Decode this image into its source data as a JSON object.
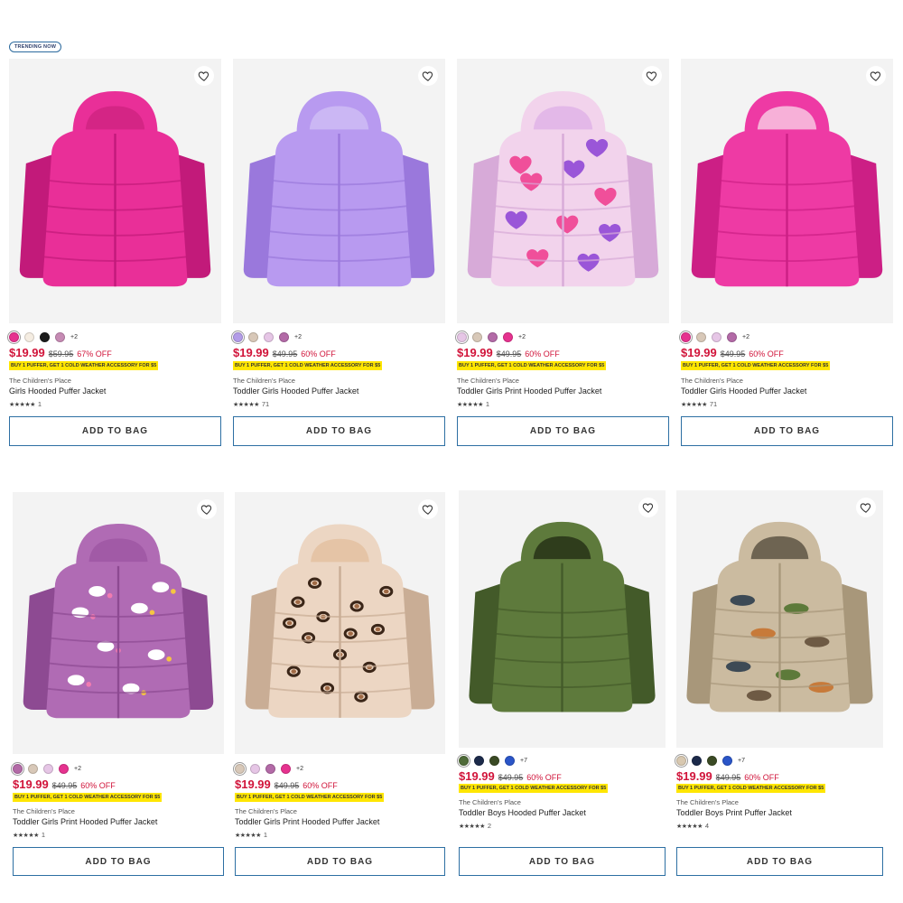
{
  "trending_label": "TRENDING NOW",
  "products": [
    {
      "brand": "The Children's Place",
      "name": "Girls Hooded Puffer Jacket",
      "price": "$19.99",
      "was": "$59.95",
      "off": "67% OFF",
      "promo": "BUY 1 PUFFER, GET 1 COLD WEATHER ACCESSORY FOR $5",
      "reviews": "1",
      "more": "+2",
      "swatches": [
        "#e6328f",
        "#f5ede2",
        "#1c1c1c",
        "#c68bb4"
      ],
      "add": "ADD TO BAG",
      "image": "hot-pink-puffer-jacket"
    },
    {
      "brand": "The Children's Place",
      "name": "Toddler Girls Hooded Puffer Jacket",
      "price": "$19.99",
      "was": "$49.95",
      "off": "60% OFF",
      "promo": "BUY 1 PUFFER, GET 1 COLD WEATHER ACCESSORY FOR $5",
      "reviews": "71",
      "more": "+2",
      "swatches": [
        "#b39ce8",
        "#d8c8b8",
        "#e6c6e6",
        "#b36aa7"
      ],
      "add": "ADD TO BAG",
      "image": "lavender-puffer-jacket"
    },
    {
      "brand": "The Children's Place",
      "name": "Toddler Girls Print Hooded Puffer Jacket",
      "price": "$19.99",
      "was": "$49.95",
      "off": "60% OFF",
      "promo": "BUY 1 PUFFER, GET 1 COLD WEATHER ACCESSORY FOR $5",
      "reviews": "1",
      "more": "+2",
      "swatches": [
        "#e6c6e6",
        "#d8c8b8",
        "#b36aa7",
        "#e6328f"
      ],
      "add": "ADD TO BAG",
      "image": "heart-print-puffer-jacket"
    },
    {
      "brand": "The Children's Place",
      "name": "Toddler Girls Hooded Puffer Jacket",
      "price": "$19.99",
      "was": "$49.95",
      "off": "60% OFF",
      "promo": "BUY 1 PUFFER, GET 1 COLD WEATHER ACCESSORY FOR $5",
      "reviews": "71",
      "more": "+2",
      "swatches": [
        "#e6328f",
        "#d8c8b8",
        "#e6c6e6",
        "#b36aa7"
      ],
      "add": "ADD TO BAG",
      "image": "pink-puffer-jacket"
    },
    {
      "brand": "The Children's Place",
      "name": "Toddler Girls Print Hooded Puffer Jacket",
      "price": "$19.99",
      "was": "$49.95",
      "off": "60% OFF",
      "promo": "BUY 1 PUFFER, GET 1 COLD WEATHER ACCESSORY FOR $5",
      "reviews": "1",
      "more": "+2",
      "swatches": [
        "#b36aa7",
        "#d8c8b8",
        "#e6c6e6",
        "#e6328f"
      ],
      "add": "ADD TO BAG",
      "image": "unicorn-print-puffer-jacket"
    },
    {
      "brand": "The Children's Place",
      "name": "Toddler Girls Print Hooded Puffer Jacket",
      "price": "$19.99",
      "was": "$49.95",
      "off": "60% OFF",
      "promo": "BUY 1 PUFFER, GET 1 COLD WEATHER ACCESSORY FOR $5",
      "reviews": "1",
      "more": "+2",
      "swatches": [
        "#d8c8b8",
        "#e6c6e6",
        "#b36aa7",
        "#e6328f"
      ],
      "add": "ADD TO BAG",
      "image": "leopard-print-puffer-jacket"
    },
    {
      "brand": "The Children's Place",
      "name": "Toddler Boys Hooded Puffer Jacket",
      "price": "$19.99",
      "was": "$49.95",
      "off": "60% OFF",
      "promo": "BUY 1 PUFFER, GET 1 COLD WEATHER ACCESSORY FOR $5",
      "reviews": "2",
      "more": "+7",
      "swatches": [
        "#4f6b39",
        "#1c2a4a",
        "#3a4a24",
        "#2a55c8"
      ],
      "add": "ADD TO BAG",
      "image": "olive-puffer-jacket"
    },
    {
      "brand": "The Children's Place",
      "name": "Toddler Boys Print Puffer Jacket",
      "price": "$19.99",
      "was": "$49.95",
      "off": "60% OFF",
      "promo": "BUY 1 PUFFER, GET 1 COLD WEATHER ACCESSORY FOR $5",
      "reviews": "4",
      "more": "+7",
      "swatches": [
        "#d8c8b0",
        "#1c2a4a",
        "#3a4a24",
        "#2a55c8"
      ],
      "add": "ADD TO BAG",
      "image": "dinosaur-print-puffer-jacket"
    }
  ],
  "colors": {
    "sale_red": "#d1143a",
    "promo_yellow": "#ffe600",
    "button_border": "#2d6fa3"
  }
}
